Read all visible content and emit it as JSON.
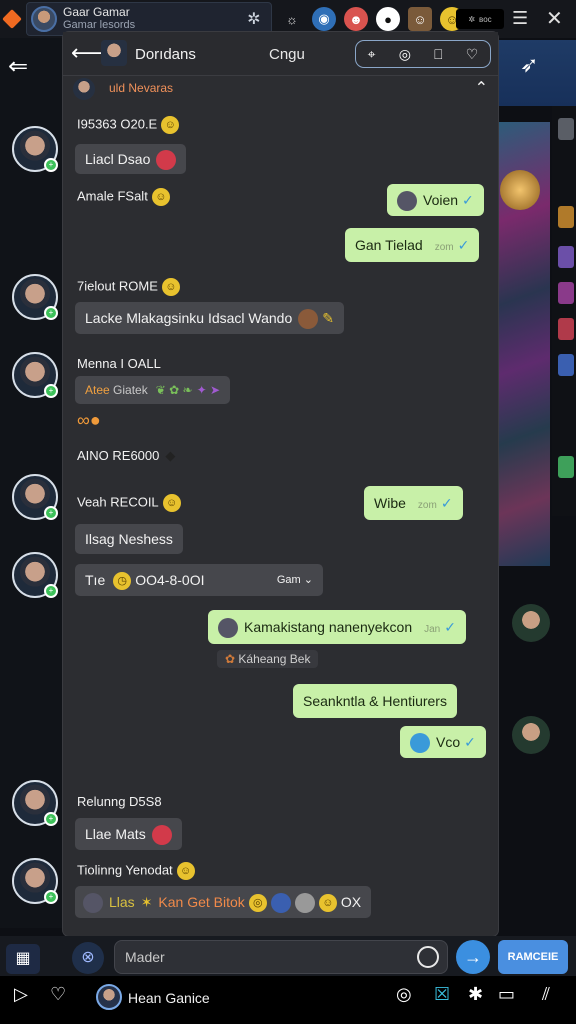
{
  "topbar": {
    "profile_name": "Gaar Gamar",
    "profile_sub": "Gamar lesords",
    "pill_label": "вос"
  },
  "chat": {
    "title": "Dorıdans",
    "subtitle": "Cngu",
    "pinned": "uld Nevaras",
    "messages": [
      {
        "sender": "I95363 O20.E",
        "text": "Liacl Dsao"
      },
      {
        "sender": "Amale FSalt",
        "text": ""
      },
      {
        "out": "Voien"
      },
      {
        "out": "Gan Tielad",
        "time": "zom"
      },
      {
        "sender": "7ielout ROME",
        "text": "Lacke Mlakagsinku Idsacl Wando"
      },
      {
        "sender": "Menna I OALL",
        "text": "Giatek",
        "prefix": "Atee"
      },
      {
        "sender": "AINO RE6000"
      },
      {
        "out": "Wibe",
        "time": "zom"
      },
      {
        "sender": "Veah RECOIL",
        "text": "Ilsag Neshess"
      },
      {
        "text": "Tıe",
        "date": "OO4-8-0OI",
        "tail": "Gam"
      },
      {
        "out": "Kamakistang nanenyekcon",
        "time": "Jan"
      },
      {
        "sticker": "Káheang Bek"
      },
      {
        "out": "Seankntla & Hentiurers"
      },
      {
        "out": "Vco"
      },
      {
        "sender": "Relunng D5S8",
        "text": "Llae Mats"
      },
      {
        "sender": "Tiolinng Yenodat",
        "text": "Llas",
        "extra": "Kan Get Bitok",
        "tail": "OX"
      }
    ]
  },
  "input": {
    "placeholder": "Mader",
    "action_button": "RAMCEIE"
  },
  "bottom": {
    "name": "Hean Ganice"
  }
}
